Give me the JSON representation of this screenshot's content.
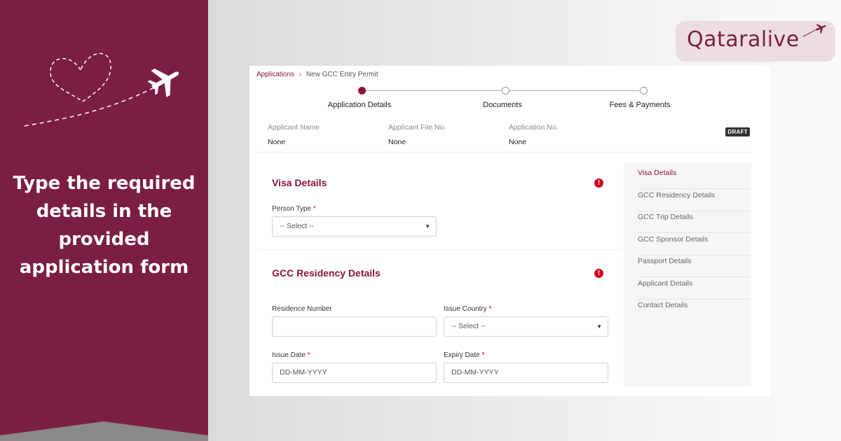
{
  "left_panel": {
    "headline": "Type the required\ndetails in the\nprovided\napplication form",
    "bg_color": "#7a1f42"
  },
  "logo": {
    "text": "Qataralive",
    "icon": "airplane-icon"
  },
  "app": {
    "breadcrumb": {
      "link": "Applications",
      "separator": "›",
      "current": "New GCC Entry Permit"
    },
    "steps": [
      {
        "label": "Application Details",
        "state": "active"
      },
      {
        "label": "Documents",
        "state": "pending"
      },
      {
        "label": "Fees & Payments",
        "state": "pending"
      }
    ],
    "info": {
      "applicant_name_label": "Applicant Name",
      "applicant_name_value": "None",
      "file_no_label": "Applicant File No.",
      "file_no_value": "None",
      "application_no_label": "Application No.",
      "application_no_value": "None",
      "status_badge": "DRAFT"
    },
    "visa_details": {
      "title": "Visa Details",
      "person_type_label": "Person Type",
      "person_type_value": "-- Select --",
      "alert_icon": "!"
    },
    "gcc_residency": {
      "title": "GCC Residency Details",
      "alert_icon": "!",
      "residence_number_label": "Residence Number",
      "residence_number_value": "",
      "issue_country_label": "Issue Country",
      "issue_country_value": "-- Select --",
      "issue_date_label": "Issue Date",
      "issue_date_placeholder": "DD-MM-YYYY",
      "expiry_date_label": "Expiry Date",
      "expiry_date_placeholder": "DD-MM-YYYY"
    },
    "required_marker": "*",
    "side_nav": [
      "Visa Details",
      "GCC Residency Details",
      "GCC Trip Details",
      "GCC Sponsor Details",
      "Passport Details",
      "Applicant Details",
      "Contact Details"
    ],
    "accent_color": "#8a1538"
  }
}
